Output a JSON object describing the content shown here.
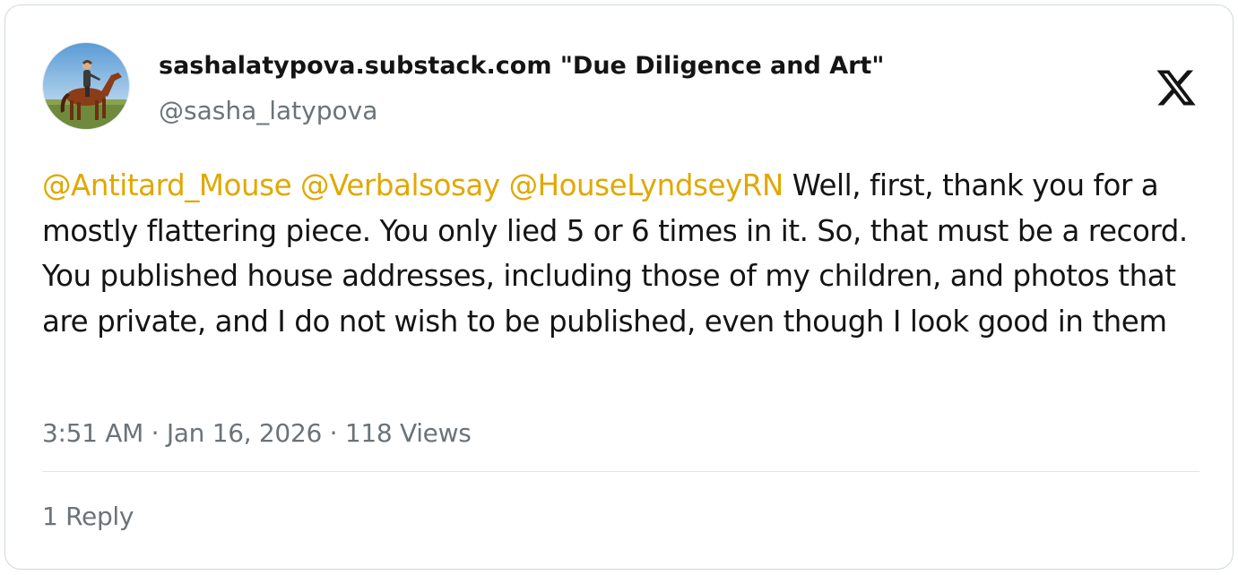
{
  "author": {
    "display_name": "sashalatypova.substack.com \"Due Diligence and Art\"",
    "handle": "@sasha_latypova",
    "avatar_icon": "rider-on-horse-avatar"
  },
  "platform": {
    "logo_icon": "x-logo-icon"
  },
  "tweet": {
    "mentions": [
      "@Antitard_Mouse",
      "@Verbalsosay",
      "@HouseLyndseyRN"
    ],
    "body": "Well, first, thank you for a mostly flattering piece. You only lied 5 or 6 times in it. So, that must be a record. You published house addresses, including those of my children, and photos that are private, and I do not wish to be published, even though I look good in them",
    "time": "3:51 AM",
    "date": "Jan 16, 2026",
    "views": "118 Views",
    "separator": "·"
  },
  "footer": {
    "replies": "1 Reply"
  },
  "colors": {
    "mention": "#e1a800",
    "text": "#141414",
    "secondary": "#6b7378",
    "border": "#cfd9de"
  }
}
